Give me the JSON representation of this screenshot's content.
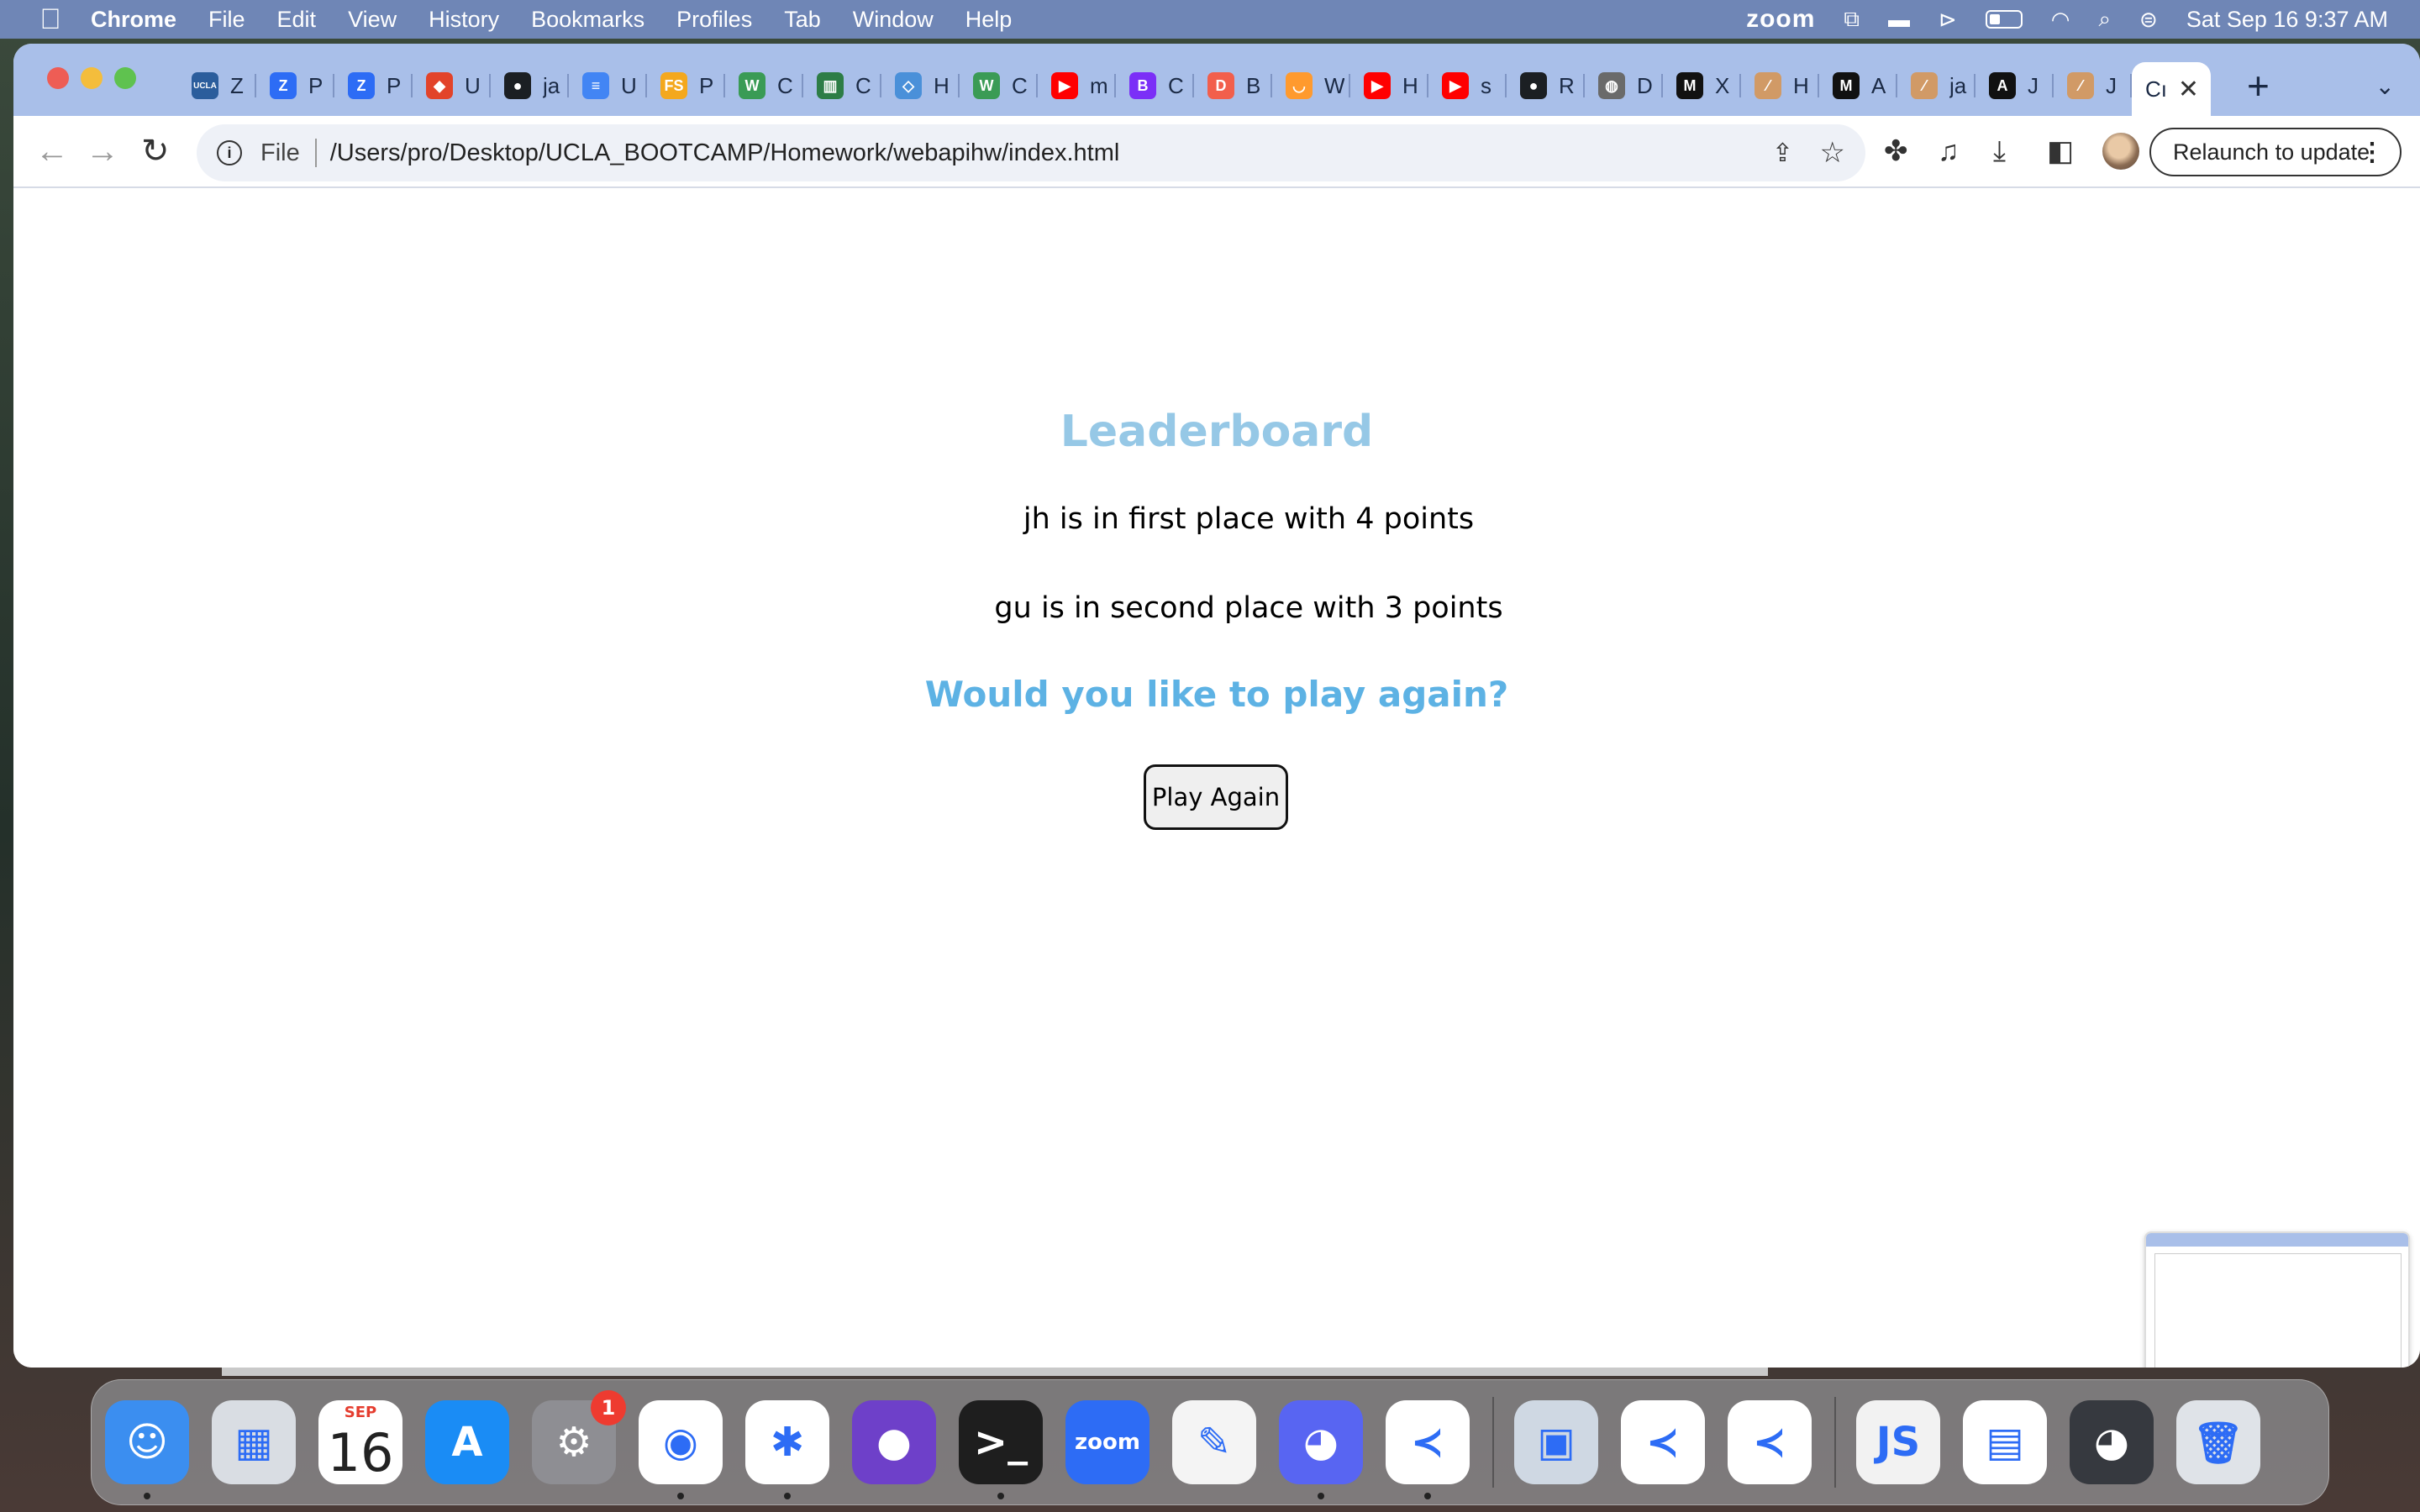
{
  "menubar": {
    "app_name": "Chrome",
    "items": [
      "File",
      "Edit",
      "View",
      "History",
      "Bookmarks",
      "Profiles",
      "Tab",
      "Window",
      "Help"
    ],
    "zoom_label": "zoom",
    "clock": "Sat Sep 16  9:37 AM"
  },
  "tabs": [
    {
      "title": "Z",
      "icon": "ucla-icon",
      "color": "#2b5d9c",
      "glyph": "UCLA"
    },
    {
      "title": "P",
      "icon": "zoom-icon",
      "color": "#2d6cf5",
      "glyph": "Z"
    },
    {
      "title": "P",
      "icon": "zoom-icon",
      "color": "#2d6cf5",
      "glyph": "Z"
    },
    {
      "title": "U",
      "icon": "gitlab-icon",
      "color": "#e2432a",
      "glyph": "◆"
    },
    {
      "title": "ja",
      "icon": "github-icon",
      "color": "#1b1f23",
      "glyph": "●"
    },
    {
      "title": "U",
      "icon": "docs-icon",
      "color": "#4285f4",
      "glyph": "≡"
    },
    {
      "title": "P",
      "icon": "fs-icon",
      "color": "#f4a81d",
      "glyph": "FS"
    },
    {
      "title": "C",
      "icon": "w3-icon",
      "color": "#3a9b55",
      "glyph": "W"
    },
    {
      "title": "C",
      "icon": "book-icon",
      "color": "#2d7d46",
      "glyph": "▥"
    },
    {
      "title": "H",
      "icon": "code-icon",
      "color": "#4a90d9",
      "glyph": "◇"
    },
    {
      "title": "C",
      "icon": "w3-icon",
      "color": "#3a9b55",
      "glyph": "W"
    },
    {
      "title": "m",
      "icon": "youtube-icon",
      "color": "#ff0000",
      "glyph": "▶"
    },
    {
      "title": "C",
      "icon": "bootstrap-icon",
      "color": "#7b2ff7",
      "glyph": "B"
    },
    {
      "title": "B",
      "icon": "dayjs-icon",
      "color": "#f25f4c",
      "glyph": "D"
    },
    {
      "title": "W",
      "icon": "fox-icon",
      "color": "#ff9a2e",
      "glyph": "◡"
    },
    {
      "title": "H",
      "icon": "youtube-icon",
      "color": "#ff0000",
      "glyph": "▶"
    },
    {
      "title": "s",
      "icon": "youtube-icon",
      "color": "#ff0000",
      "glyph": "▶"
    },
    {
      "title": "R",
      "icon": "github-icon",
      "color": "#1b1f23",
      "glyph": "●"
    },
    {
      "title": "D",
      "icon": "globe-icon",
      "color": "#6a6a6a",
      "glyph": "◍"
    },
    {
      "title": "X",
      "icon": "m-icon",
      "color": "#111111",
      "glyph": "M"
    },
    {
      "title": "H",
      "icon": "quill-icon",
      "color": "#d19a66",
      "glyph": "⁄"
    },
    {
      "title": "A",
      "icon": "m-icon",
      "color": "#111111",
      "glyph": "M"
    },
    {
      "title": "ja",
      "icon": "quill-icon",
      "color": "#d19a66",
      "glyph": "⁄"
    },
    {
      "title": "J",
      "icon": "a-icon",
      "color": "#111111",
      "glyph": "A"
    },
    {
      "title": "J",
      "icon": "quill-icon",
      "color": "#d19a66",
      "glyph": "⁄"
    }
  ],
  "active_tab": {
    "title": "Cı"
  },
  "omnibox": {
    "scheme": "File",
    "url": "/Users/pro/Desktop/UCLA_BOOTCAMP/Homework/webapihw/index.html"
  },
  "relaunch_label": "Relaunch to update",
  "page": {
    "title": "Leaderboard",
    "first_place": "jh is in first place with 4 points",
    "second_place": "gu is in second place with 3 points",
    "prompt": "Would you like to play again?",
    "play_again_label": "Play Again"
  },
  "dock": [
    {
      "name": "finder-icon",
      "color": "#3b8ef0",
      "glyph": "☺",
      "running": true
    },
    {
      "name": "launchpad-icon",
      "color": "#d9dde3",
      "glyph": "▦",
      "running": false
    },
    {
      "name": "calendar-icon",
      "color": "#ffffff",
      "glyph": "",
      "running": false,
      "month": "SEP",
      "day": "16"
    },
    {
      "name": "app-store-icon",
      "color": "#1a8cf5",
      "glyph": "A",
      "running": false
    },
    {
      "name": "system-settings-icon",
      "color": "#8e8e93",
      "glyph": "⚙",
      "running": false,
      "badge": "1"
    },
    {
      "name": "chrome-icon",
      "color": "#ffffff",
      "glyph": "◉",
      "running": true
    },
    {
      "name": "slack-icon",
      "color": "#ffffff",
      "glyph": "✱",
      "running": true
    },
    {
      "name": "github-desktop-icon",
      "color": "#6e40c9",
      "glyph": "●",
      "running": false
    },
    {
      "name": "terminal-icon",
      "color": "#1e1e1e",
      "glyph": ">_",
      "running": true
    },
    {
      "name": "zoom-icon",
      "color": "#2d6cf5",
      "glyph": "zoom",
      "running": false
    },
    {
      "name": "textedit-icon",
      "color": "#f4f4f4",
      "glyph": "✎",
      "running": false
    },
    {
      "name": "discord-icon",
      "color": "#5865f2",
      "glyph": "◕",
      "running": true
    },
    {
      "name": "vscode-icon",
      "color": "#ffffff",
      "glyph": "≺",
      "running": true
    },
    {
      "name": "preview-icon",
      "color": "#cfd8e3",
      "glyph": "▣",
      "running": false
    },
    {
      "name": "vscode-icon",
      "color": "#ffffff",
      "glyph": "≺",
      "running": false
    },
    {
      "name": "vscode-icon",
      "color": "#ffffff",
      "glyph": "≺",
      "running": false
    },
    {
      "name": "js-file-icon",
      "color": "#f2f2f2",
      "glyph": "JS",
      "running": false
    },
    {
      "name": "spreadsheet-icon",
      "color": "#ffffff",
      "glyph": "▤",
      "running": false
    },
    {
      "name": "discord-window-icon",
      "color": "#36393f",
      "glyph": "◕",
      "running": false
    },
    {
      "name": "trash-icon",
      "color": "#dfe3e8",
      "glyph": "🗑",
      "running": false
    }
  ]
}
